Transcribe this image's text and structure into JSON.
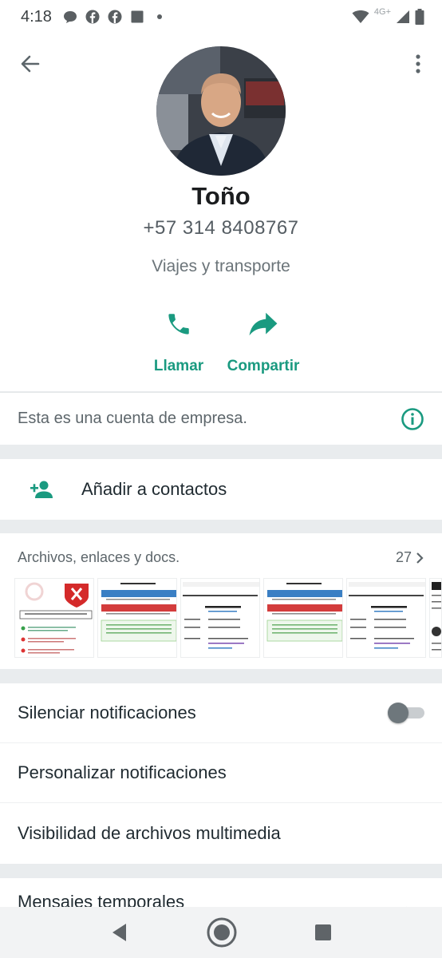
{
  "status_bar": {
    "time": "4:18",
    "network": "4G+",
    "icons": [
      "chat-bubble-icon",
      "facebook-icon",
      "facebook-icon",
      "square-icon",
      "dot-icon",
      "wifi-icon",
      "signal-icon",
      "battery-icon"
    ]
  },
  "header": {
    "back_icon": "arrow-left-icon",
    "menu_icon": "more-vert-icon"
  },
  "profile": {
    "name": "Toño",
    "phone": "+57 314 8408767",
    "category": "Viajes y transporte"
  },
  "actions": [
    {
      "label": "Llamar",
      "icon": "phone-icon"
    },
    {
      "label": "Compartir",
      "icon": "share-icon"
    }
  ],
  "business": {
    "text": "Esta es una cuenta de empresa.",
    "icon": "info-icon"
  },
  "add_contact": {
    "label": "Añadir a contactos",
    "icon": "person-add-icon"
  },
  "media": {
    "title": "Archivos, enlaces y docs.",
    "count": "27"
  },
  "settings": {
    "mute": {
      "label": "Silenciar notificaciones",
      "enabled": false
    },
    "custom": {
      "label": "Personalizar notificaciones"
    },
    "visibility": {
      "label": "Visibilidad de archivos multimedia"
    },
    "temporary": {
      "label": "Mensajes temporales"
    }
  },
  "colors": {
    "accent": "#1a9a80",
    "background": "#ffffff",
    "separator": "#e9ecee"
  }
}
